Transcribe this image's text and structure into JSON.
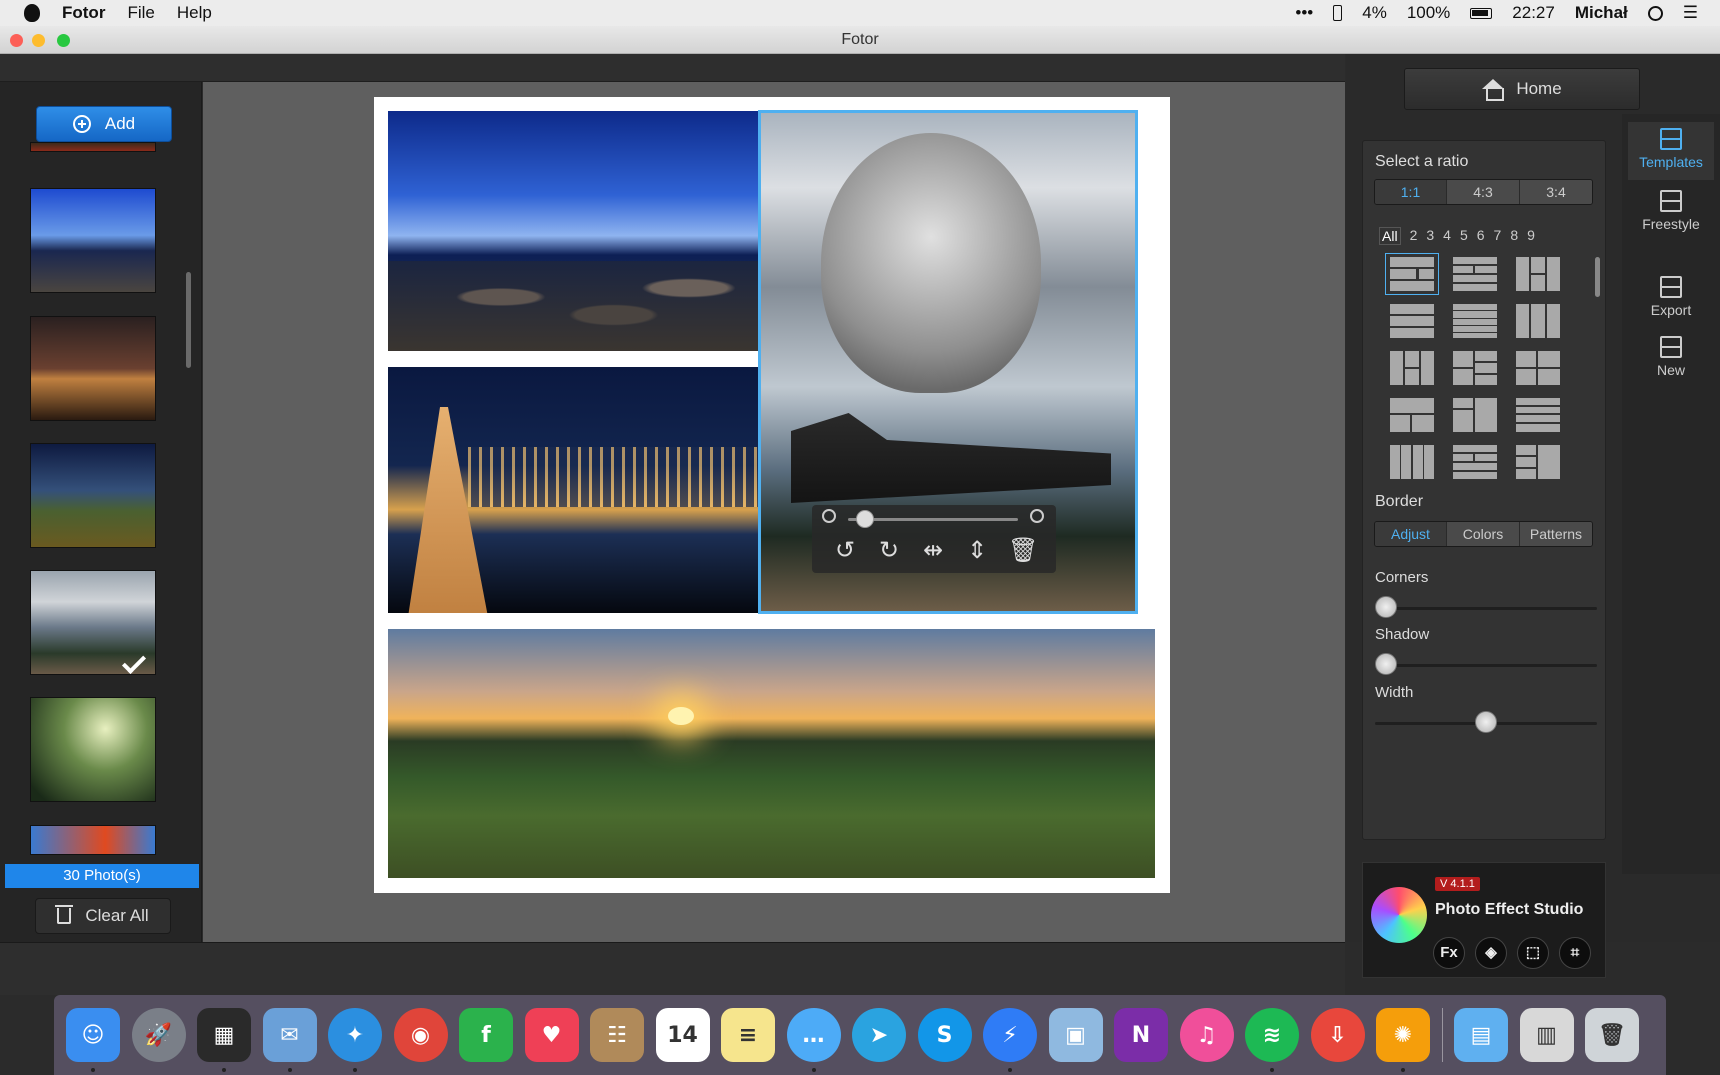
{
  "menubar": {
    "app_name": "Fotor",
    "menus": [
      "File",
      "Help"
    ],
    "status": {
      "dots": "•••",
      "battery_small": "4%",
      "battery": "100%",
      "time": "22:27",
      "user": "Michał"
    }
  },
  "window": {
    "title": "Fotor"
  },
  "left_panel": {
    "add_label": "Add",
    "photo_count": "30 Photo(s)",
    "clear_label": "Clear All"
  },
  "right_panel": {
    "home_label": "Home",
    "ratio": {
      "title": "Select a ratio",
      "options": [
        "1:1",
        "4:3",
        "3:4"
      ],
      "selected": "1:1"
    },
    "count_tabs": [
      "All",
      "2",
      "3",
      "4",
      "5",
      "6",
      "7",
      "8",
      "9"
    ],
    "border": {
      "title": "Border",
      "tabs": [
        "Adjust",
        "Colors",
        "Patterns"
      ],
      "selected": "Adjust",
      "sliders": [
        {
          "label": "Corners",
          "value": 0
        },
        {
          "label": "Shadow",
          "value": 0
        },
        {
          "label": "Width",
          "value": 0.5
        }
      ]
    },
    "nav": [
      {
        "label": "Templates",
        "active": true
      },
      {
        "label": "Freestyle",
        "active": false
      },
      {
        "label": "Export",
        "active": false
      },
      {
        "label": "New",
        "active": false
      }
    ],
    "promo": {
      "version": "V 4.1.1",
      "title": "Photo Effect Studio",
      "tools": [
        "Fx",
        "◈",
        "⬚",
        "⌗"
      ]
    }
  },
  "image_tools": {
    "zoom_value": 0.1
  },
  "dock": {
    "apps": [
      {
        "name": "finder",
        "color": "#3a8ef0",
        "glyph": "☺"
      },
      {
        "name": "launchpad",
        "color": "#7a7f88",
        "glyph": "🚀"
      },
      {
        "name": "photo-app",
        "color": "#2a2a2a",
        "glyph": "▦"
      },
      {
        "name": "mail",
        "color": "#6aa0d8",
        "glyph": "✉"
      },
      {
        "name": "safari",
        "color": "#2b8fe0",
        "glyph": "✦"
      },
      {
        "name": "chrome",
        "color": "#e0453a",
        "glyph": "◉"
      },
      {
        "name": "feedly",
        "color": "#2bb24c",
        "glyph": "f"
      },
      {
        "name": "pocket",
        "color": "#ef4056",
        "glyph": "♥"
      },
      {
        "name": "contacts",
        "color": "#b08a5a",
        "glyph": "☷"
      },
      {
        "name": "calendar",
        "color": "#ffffff",
        "glyph": "14"
      },
      {
        "name": "notes",
        "color": "#f6e58d",
        "glyph": "≡"
      },
      {
        "name": "messages",
        "color": "#4dabf7",
        "glyph": "…"
      },
      {
        "name": "telegram",
        "color": "#2aa3e0",
        "glyph": "➤"
      },
      {
        "name": "skype",
        "color": "#1296e8",
        "glyph": "S"
      },
      {
        "name": "messenger",
        "color": "#2f7cf6",
        "glyph": "⚡"
      },
      {
        "name": "preview",
        "color": "#8fb9e0",
        "glyph": "▣"
      },
      {
        "name": "onenote",
        "color": "#7b2da8",
        "glyph": "N"
      },
      {
        "name": "itunes",
        "color": "#f04f9a",
        "glyph": "♫"
      },
      {
        "name": "spotify",
        "color": "#1db954",
        "glyph": "≋"
      },
      {
        "name": "downloader",
        "color": "#e8473c",
        "glyph": "⇩"
      },
      {
        "name": "colorsync",
        "color": "#f59e0b",
        "glyph": "✺"
      }
    ],
    "right_apps": [
      {
        "name": "downloads-folder",
        "color": "#5fb0f0",
        "glyph": "▤"
      },
      {
        "name": "stack",
        "color": "#d8d8d8",
        "glyph": "▥"
      },
      {
        "name": "trash",
        "color": "#cfd4d8",
        "glyph": "🗑"
      }
    ]
  }
}
